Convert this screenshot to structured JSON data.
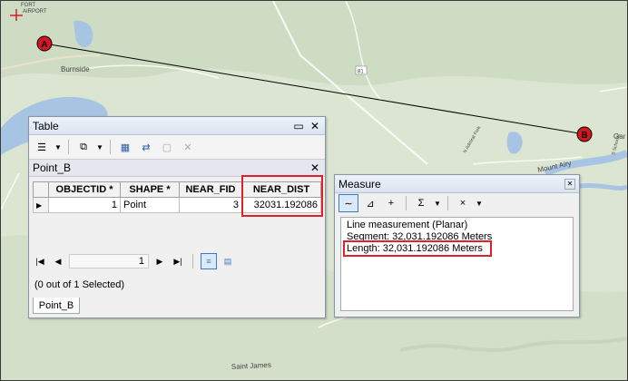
{
  "map": {
    "labels": {
      "airport_top": "FORT",
      "airport_bottom": "AIRPORT",
      "burnside": "Burnside",
      "road_81": "81",
      "mount_airy": "Mount Airy",
      "saint_james": "Saint James",
      "gary": "Gar",
      "sideroad_1": "N Admiral Fork",
      "sideroad_2": "S Schoolst"
    },
    "point_a_label": "A",
    "point_b_label": "B"
  },
  "table_window": {
    "title": "Table",
    "layer_name": "Point_B",
    "columns": [
      "",
      "OBJECTID *",
      "SHAPE *",
      "NEAR_FID",
      "NEAR_DIST"
    ],
    "rows": [
      {
        "marker": "▶",
        "objectid": "1",
        "shape": "Point",
        "near_fid": "3",
        "near_dist": "32031.192086"
      }
    ],
    "current_record": "1",
    "selection_status": "(0 out of 1 Selected)",
    "bottom_tab": "Point_B"
  },
  "measure_window": {
    "title": "Measure",
    "line1": "Line measurement (Planar)",
    "line2": "Segment: 32,031.192086 Meters",
    "line3": "Length: 32,031.192086 Meters"
  },
  "colors": {
    "highlight": "#e0202a",
    "river": "#a7c4e3",
    "land": "#d8e3cf",
    "point_fill": "#d8141c"
  }
}
